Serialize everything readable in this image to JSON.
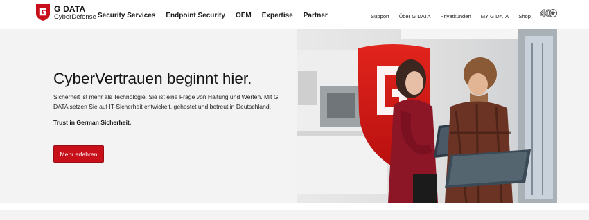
{
  "brand": {
    "name": "G DATA",
    "subtitle": "CyberDefense",
    "accent_color": "#c8101b",
    "logo_icon": "g-data-shield-icon"
  },
  "mainnav": {
    "items": [
      {
        "label": "Security Services"
      },
      {
        "label": "Endpoint Security"
      },
      {
        "label": "OEM"
      },
      {
        "label": "Expertise"
      },
      {
        "label": "Partner"
      }
    ]
  },
  "subnav": {
    "items": [
      {
        "label": "Support"
      },
      {
        "label": "Über G DATA"
      },
      {
        "label": "Privatkunden"
      },
      {
        "label": "MY G DATA"
      },
      {
        "label": "Shop"
      }
    ],
    "anniversary_badge": "40"
  },
  "hero": {
    "title": "CyberVertrauen beginnt hier.",
    "text": "Sicherheit ist mehr als Technologie. Sie ist eine Frage von Haltung und Werten. Mit G DATA setzen Sie auf IT-Sicherheit entwickelt, gehostet und betreut in Deutschland.",
    "strong": "Trust in German Sicherheit.",
    "cta_label": "Mehr erfahren"
  }
}
